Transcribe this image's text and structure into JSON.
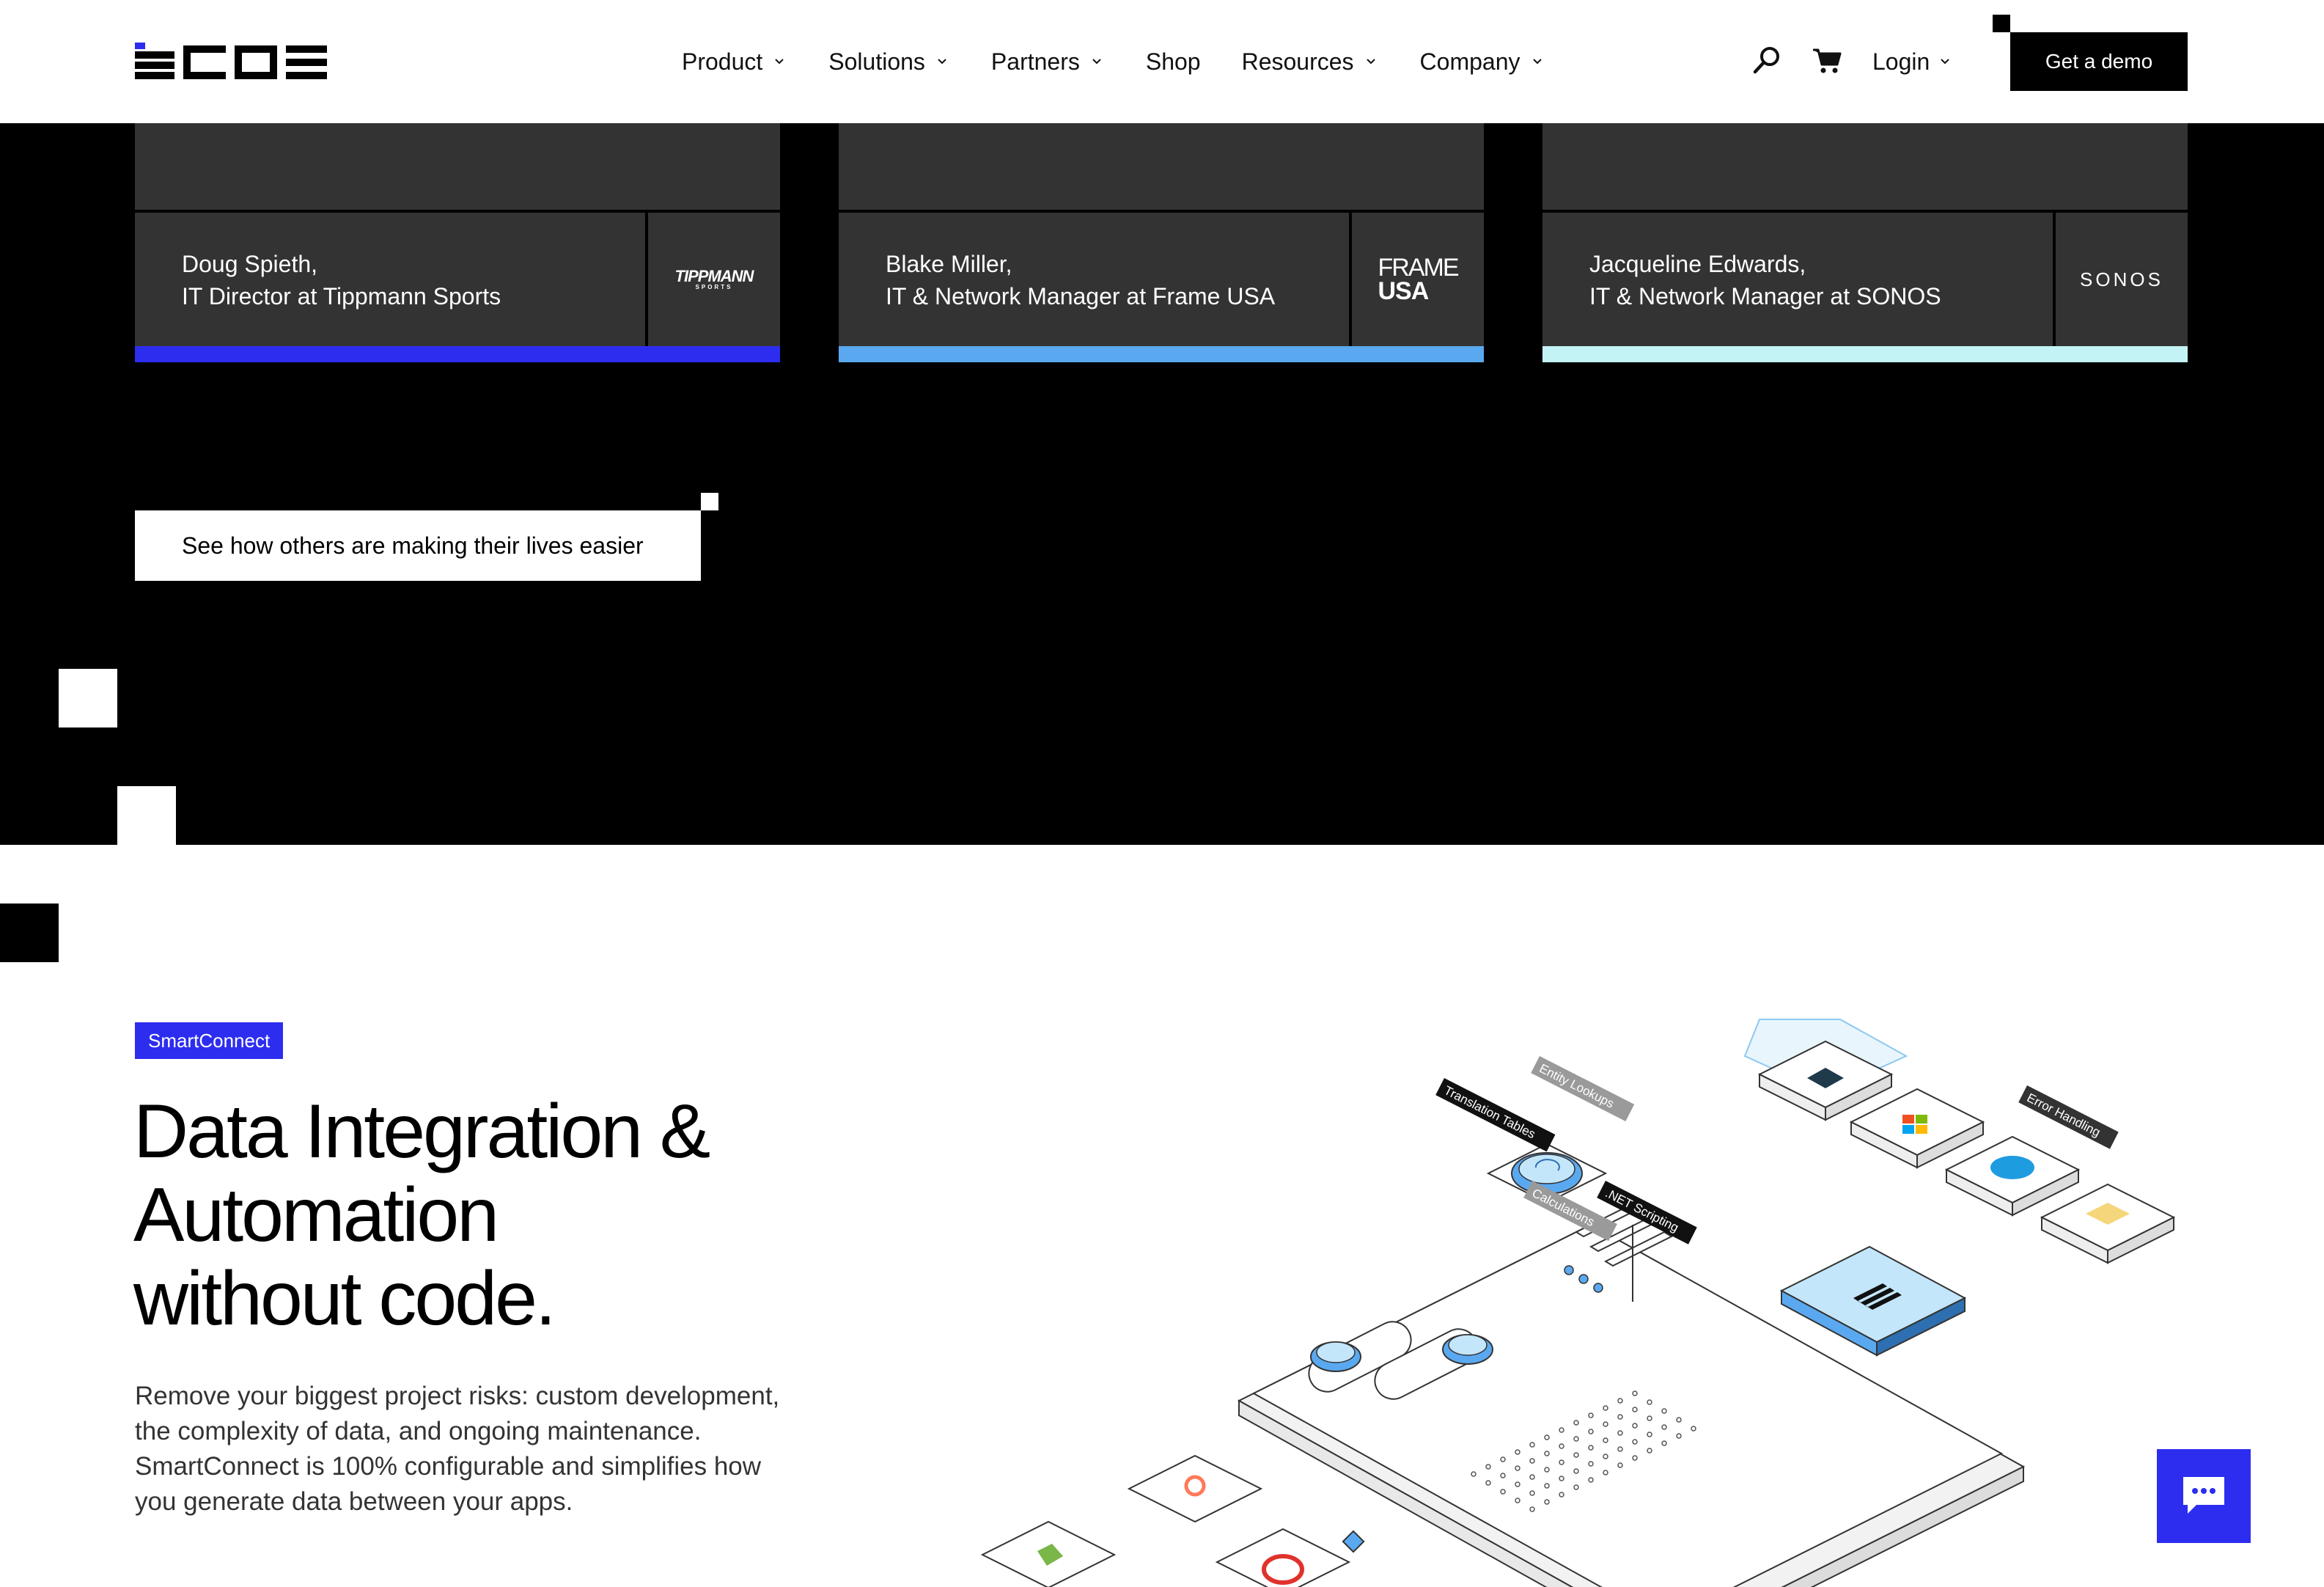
{
  "header": {
    "logo_alt": "EONE",
    "nav": [
      {
        "label": "Product",
        "has_dropdown": true
      },
      {
        "label": "Solutions",
        "has_dropdown": true
      },
      {
        "label": "Partners",
        "has_dropdown": true
      },
      {
        "label": "Shop",
        "has_dropdown": false
      },
      {
        "label": "Resources",
        "has_dropdown": true
      },
      {
        "label": "Company",
        "has_dropdown": true
      }
    ],
    "icons": [
      "search-icon",
      "cart-icon"
    ],
    "login_label": "Login",
    "demo_label": "Get a demo"
  },
  "testimonials": [
    {
      "name": "Doug Spieth,",
      "role": "IT Director at Tippmann Sports",
      "logo_text": "TIPPMANN",
      "logo_sub": "SPORTS",
      "bar_color": "#2d2df0"
    },
    {
      "name": "Blake Miller,",
      "role": "IT & Network Manager at Frame USA",
      "logo_text": "FRAME",
      "logo_sub": "USA",
      "bar_color": "#5aa9f0"
    },
    {
      "name": "Jacqueline Edwards,",
      "role": "IT & Network Manager at SONOS",
      "logo_text": "SONOS",
      "logo_sub": "",
      "bar_color": "#c4f3f6"
    }
  ],
  "cta": {
    "see_label": "See how others are making their lives easier"
  },
  "feature": {
    "badge": "SmartConnect",
    "headline": [
      "Data Integration &",
      "Automation",
      "without code."
    ],
    "description": "Remove your biggest project risks: custom development, the complexity of data, and ongoing maintenance. SmartConnect is 100% configurable and simplifies how you generate data between your apps."
  },
  "illustration_labels": {
    "translation": "Translation Tables",
    "entity": "Entity Lookups",
    "net": ".NET Scripting",
    "calc": "Calculations",
    "error": "Error Handling"
  },
  "colors": {
    "accent": "#2d2df0",
    "dark": "#000000",
    "card": "#333333",
    "light_blue": "#5aa9f0",
    "pale_blue": "#c4f3f6"
  },
  "chat_icon": "chat-icon"
}
